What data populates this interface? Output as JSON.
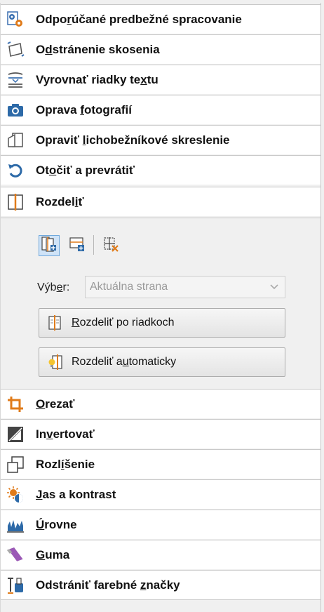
{
  "items_top": [
    {
      "name": "recommended-preprocessing",
      "icon": "gear-page-icon",
      "pre": "Odpo",
      "u": "r",
      "post": "účané predbežné spracovanie"
    },
    {
      "name": "deskew",
      "icon": "deskew-icon",
      "pre": "O",
      "u": "d",
      "post": "stránenie skosenia"
    },
    {
      "name": "straighten-lines",
      "icon": "text-lines-icon",
      "pre": "Vyrovnať riadky te",
      "u": "x",
      "post": "tu"
    },
    {
      "name": "photo-correction",
      "icon": "camera-icon",
      "pre": "Oprava ",
      "u": "f",
      "post": "otografií"
    },
    {
      "name": "trapezoid-correction",
      "icon": "trapezoid-icon",
      "pre": "Opraviť ",
      "u": "l",
      "post": "ichobežníkové skreslenie"
    },
    {
      "name": "rotate-flip",
      "icon": "rotate-icon",
      "pre": "Ot",
      "u": "o",
      "post": "čiť a prevrátiť"
    },
    {
      "name": "split",
      "icon": "split-icon",
      "pre": "Rozdel",
      "u": "i",
      "post": "ť"
    }
  ],
  "split_panel": {
    "selection_label_pre": "Výb",
    "selection_label_u": "e",
    "selection_label_post": "r:",
    "selection_value": "Aktuálna strana",
    "btn_lines_pre": "",
    "btn_lines_u": "R",
    "btn_lines_post": "ozdeliť po riadkoch",
    "btn_auto_pre": "Rozdeliť a",
    "btn_auto_u": "u",
    "btn_auto_post": "tomaticky"
  },
  "items_bottom": [
    {
      "name": "crop",
      "icon": "crop-icon",
      "pre": "",
      "u": "O",
      "post": "rezať"
    },
    {
      "name": "invert",
      "icon": "invert-icon",
      "pre": "In",
      "u": "v",
      "post": "ertovať"
    },
    {
      "name": "resolution",
      "icon": "resolution-icon",
      "pre": "Rozl",
      "u": "í",
      "post": "šenie"
    },
    {
      "name": "brightness-contrast",
      "icon": "brightness-icon",
      "pre": "",
      "u": "J",
      "post": "as a kontrast"
    },
    {
      "name": "levels",
      "icon": "levels-icon",
      "pre": "",
      "u": "Ú",
      "post": "rovne"
    },
    {
      "name": "eraser",
      "icon": "eraser-icon",
      "pre": "",
      "u": "G",
      "post": "uma"
    },
    {
      "name": "remove-color-marks",
      "icon": "color-marks-icon",
      "pre": "Odstrániť farebné ",
      "u": "z",
      "post": "načky"
    }
  ]
}
